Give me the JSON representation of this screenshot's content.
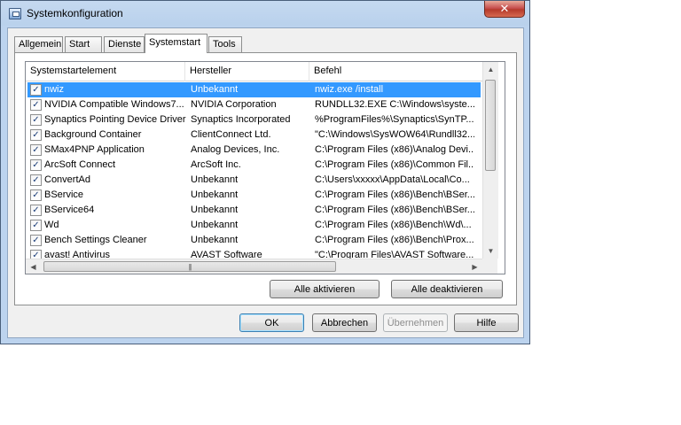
{
  "window": {
    "title": "Systemkonfiguration",
    "close_label": "✕"
  },
  "tabs": [
    {
      "label": "Allgemein"
    },
    {
      "label": "Start"
    },
    {
      "label": "Dienste"
    },
    {
      "label": "Systemstart",
      "active": true
    },
    {
      "label": "Tools"
    }
  ],
  "table": {
    "columns": [
      "Systemstartelement",
      "Hersteller",
      "Befehl"
    ],
    "rows": [
      {
        "name": "nwiz",
        "manufacturer": "Unbekannt",
        "command": "nwiz.exe /install",
        "checked": true,
        "selected": true
      },
      {
        "name": "NVIDIA Compatible Windows7...",
        "manufacturer": "NVIDIA Corporation",
        "command": "RUNDLL32.EXE C:\\Windows\\syste...",
        "checked": true
      },
      {
        "name": "Synaptics Pointing Device Driver",
        "manufacturer": "Synaptics Incorporated",
        "command": "%ProgramFiles%\\Synaptics\\SynTP...",
        "checked": true
      },
      {
        "name": "Background Container",
        "manufacturer": "ClientConnect Ltd.",
        "command": "\"C:\\Windows\\SysWOW64\\Rundll32....",
        "checked": true
      },
      {
        "name": "SMax4PNP Application",
        "manufacturer": "Analog Devices, Inc.",
        "command": "C:\\Program Files (x86)\\Analog Devi...",
        "checked": true
      },
      {
        "name": "ArcSoft Connect",
        "manufacturer": "ArcSoft Inc.",
        "command": "C:\\Program Files (x86)\\Common Fil...",
        "checked": true
      },
      {
        "name": "ConvertAd",
        "manufacturer": "Unbekannt",
        "command": "C:\\Users\\xxxxx\\AppData\\Local\\Co...",
        "checked": true
      },
      {
        "name": "BService",
        "manufacturer": "Unbekannt",
        "command": "C:\\Program Files (x86)\\Bench\\BSer...",
        "checked": true
      },
      {
        "name": "BService64",
        "manufacturer": "Unbekannt",
        "command": "C:\\Program Files (x86)\\Bench\\BSer...",
        "checked": true
      },
      {
        "name": "Wd",
        "manufacturer": "Unbekannt",
        "command": "C:\\Program Files (x86)\\Bench\\Wd\\...",
        "checked": true
      },
      {
        "name": "Bench Settings Cleaner",
        "manufacturer": "Unbekannt",
        "command": "C:\\Program Files (x86)\\Bench\\Prox...",
        "checked": true
      },
      {
        "name": "avast! Antivirus",
        "manufacturer": "AVAST Software",
        "command": "\"C:\\Program Files\\AVAST Software...",
        "checked": true
      }
    ]
  },
  "actions": {
    "enable_all": "Alle aktivieren",
    "disable_all": "Alle deaktivieren"
  },
  "dialog_buttons": {
    "ok": "OK",
    "cancel": "Abbrechen",
    "apply": "Übernehmen",
    "help": "Hilfe"
  },
  "checkmark": "✓"
}
